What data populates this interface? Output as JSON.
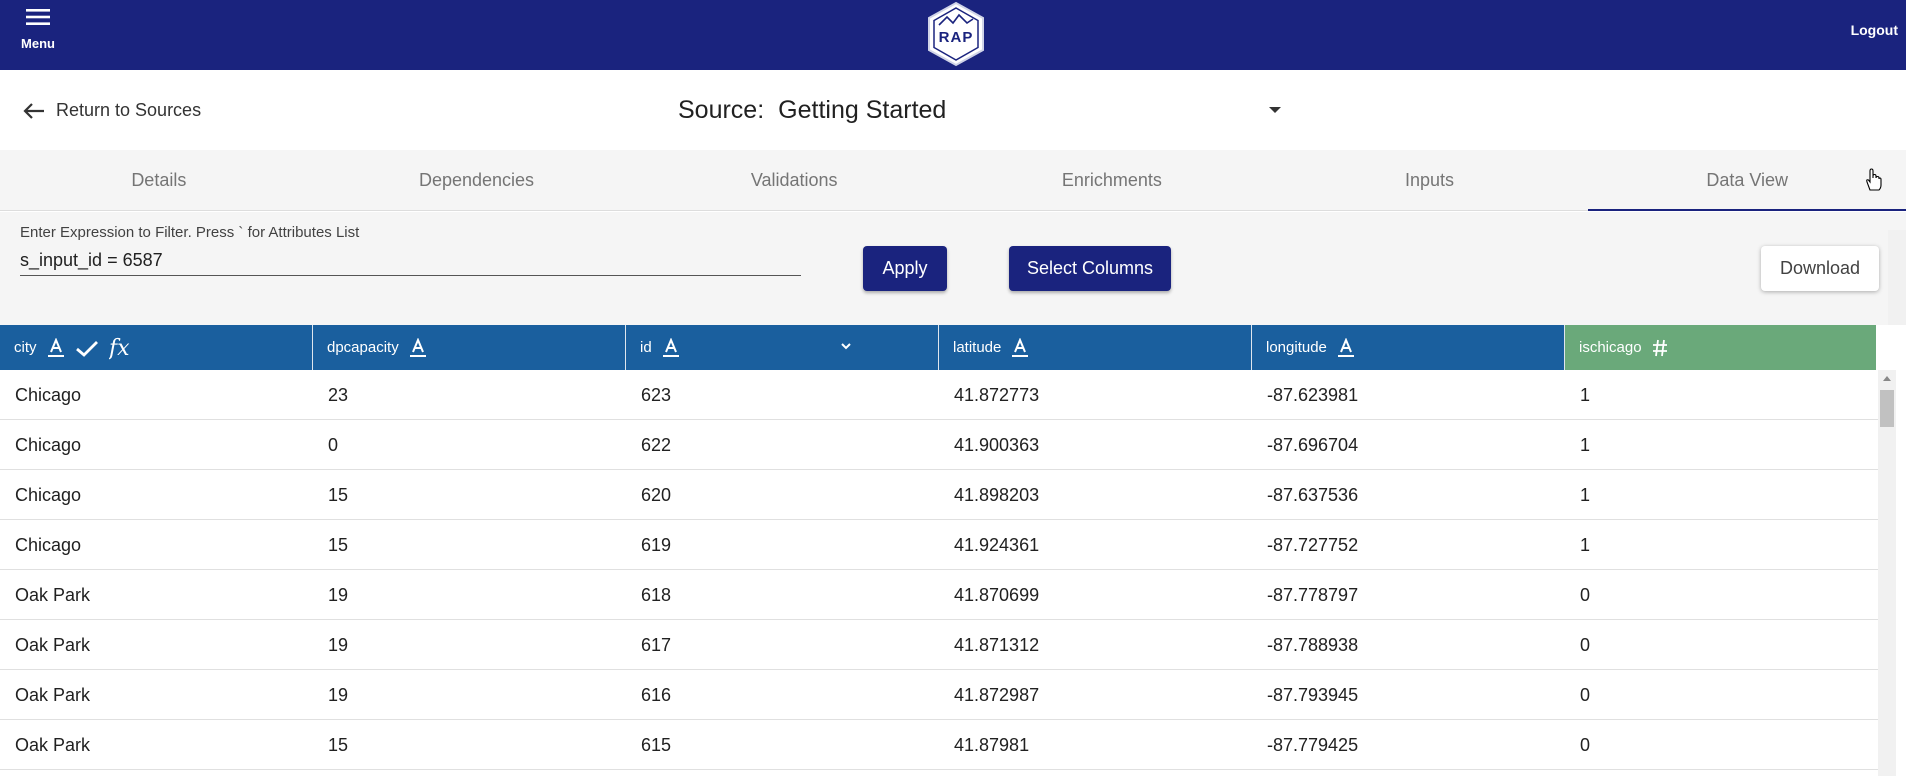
{
  "header": {
    "menu_label": "Menu",
    "logo_text": "RAP",
    "logout_label": "Logout"
  },
  "source": {
    "return_label": "Return to Sources",
    "label": "Source:",
    "name": "Getting Started"
  },
  "tabs": [
    {
      "label": "Details"
    },
    {
      "label": "Dependencies"
    },
    {
      "label": "Validations"
    },
    {
      "label": "Enrichments"
    },
    {
      "label": "Inputs"
    },
    {
      "label": "Data View",
      "active": true
    }
  ],
  "filter": {
    "label": "Enter Expression to Filter. Press ` for Attributes List",
    "value": "s_input_id = 6587",
    "apply_label": "Apply",
    "select_columns_label": "Select Columns",
    "download_label": "Download"
  },
  "table": {
    "columns": [
      {
        "name": "city",
        "type_icon": "text-type-icon",
        "extra_icons": [
          "check-icon",
          "function-icon"
        ]
      },
      {
        "name": "dpcapacity",
        "type_icon": "text-type-icon"
      },
      {
        "name": "id",
        "type_icon": "text-type-icon",
        "dropdown": true
      },
      {
        "name": "latitude",
        "type_icon": "text-type-icon"
      },
      {
        "name": "longitude",
        "type_icon": "text-type-icon"
      },
      {
        "name": "ischicago",
        "type_icon": "number-type-icon"
      }
    ],
    "rows": [
      [
        "Chicago",
        "23",
        "623",
        "41.872773",
        "-87.623981",
        "1"
      ],
      [
        "Chicago",
        "0",
        "622",
        "41.900363",
        "-87.696704",
        "1"
      ],
      [
        "Chicago",
        "15",
        "620",
        "41.898203",
        "-87.637536",
        "1"
      ],
      [
        "Chicago",
        "15",
        "619",
        "41.924361",
        "-87.727752",
        "1"
      ],
      [
        "Oak Park",
        "19",
        "618",
        "41.870699",
        "-87.778797",
        "0"
      ],
      [
        "Oak Park",
        "19",
        "617",
        "41.871312",
        "-87.788938",
        "0"
      ],
      [
        "Oak Park",
        "19",
        "616",
        "41.872987",
        "-87.793945",
        "0"
      ],
      [
        "Oak Park",
        "15",
        "615",
        "41.87981",
        "-87.779425",
        "0"
      ]
    ]
  },
  "colors": {
    "primary": "#1a237e",
    "header_blue": "#1a5f9e",
    "header_green": "#6aa97a"
  }
}
